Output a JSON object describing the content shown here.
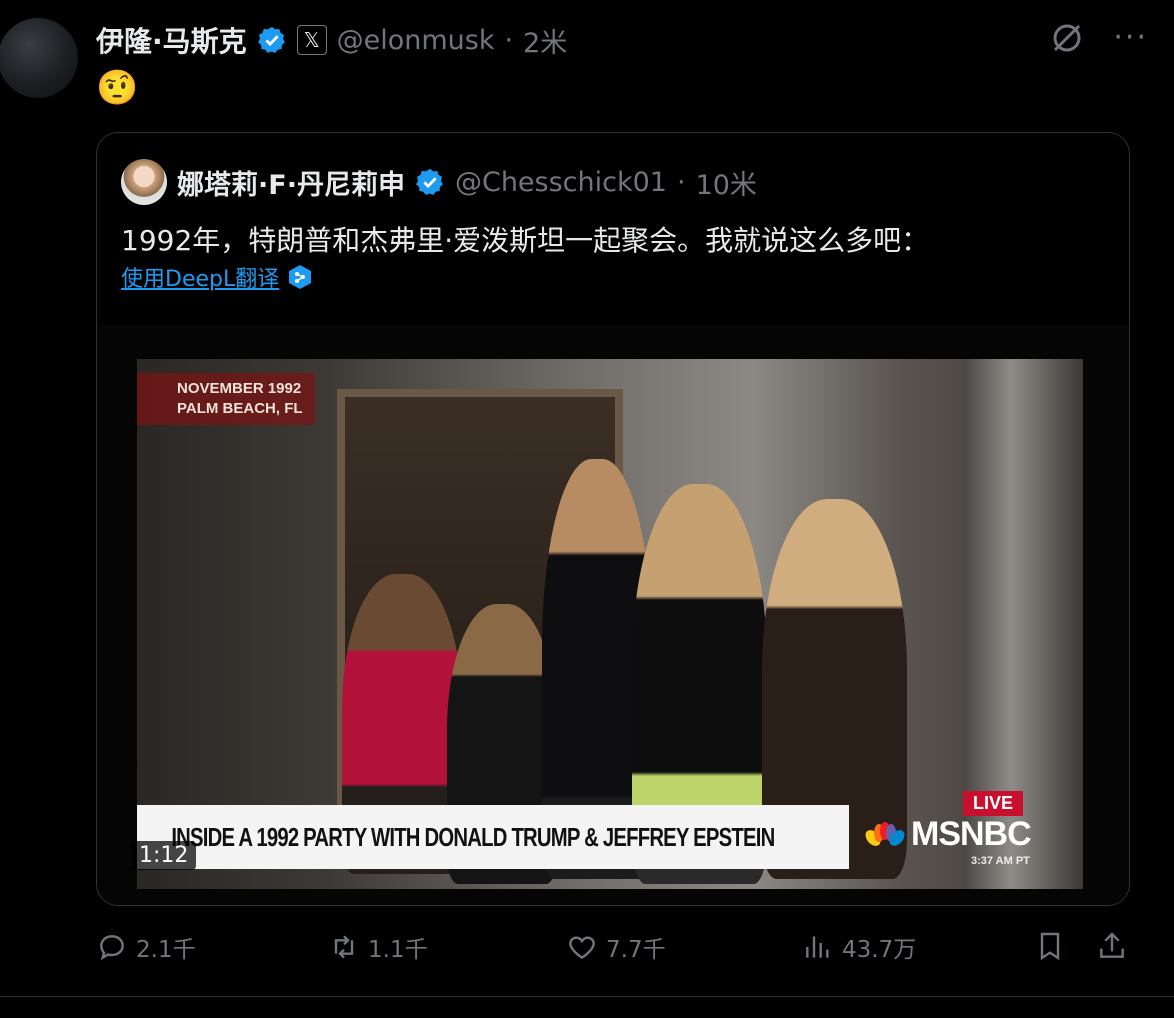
{
  "tweet": {
    "author_name": "伊隆·马斯克",
    "handle": "@elonmusk",
    "time": "2米",
    "separator": "·",
    "body_emoji": "🤨",
    "author_icon": "verified-badge",
    "affiliation_icon": "x-logo",
    "affiliation_glyph": "𝕏"
  },
  "quote": {
    "author_name": "娜塔莉·F·丹尼莉申",
    "handle": "@Chesschick01",
    "time": "10米",
    "separator": "·",
    "text": "1992年，特朗普和杰弗里·爱泼斯坦一起聚会。我就说这么多吧：",
    "translate_label": "使用DeepL翻译",
    "video": {
      "dateline_line1": "NOVEMBER 1992",
      "dateline_line2": "PALM BEACH, FL",
      "lower_third": "INSIDE A 1992 PARTY WITH DONALD TRUMP & JEFFREY EPSTEIN",
      "live_label": "LIVE",
      "network": "MSNBC",
      "clock": "3:37 AM PT",
      "duration": "1:12"
    }
  },
  "actions": {
    "replies": "2.1千",
    "reposts": "1.1千",
    "likes": "7.7千",
    "views": "43.7万"
  },
  "colors": {
    "accent": "#1d9bf0",
    "muted": "#71767b",
    "text": "#e7e9ea",
    "border": "#2f3336",
    "live_red": "#c8102e"
  }
}
